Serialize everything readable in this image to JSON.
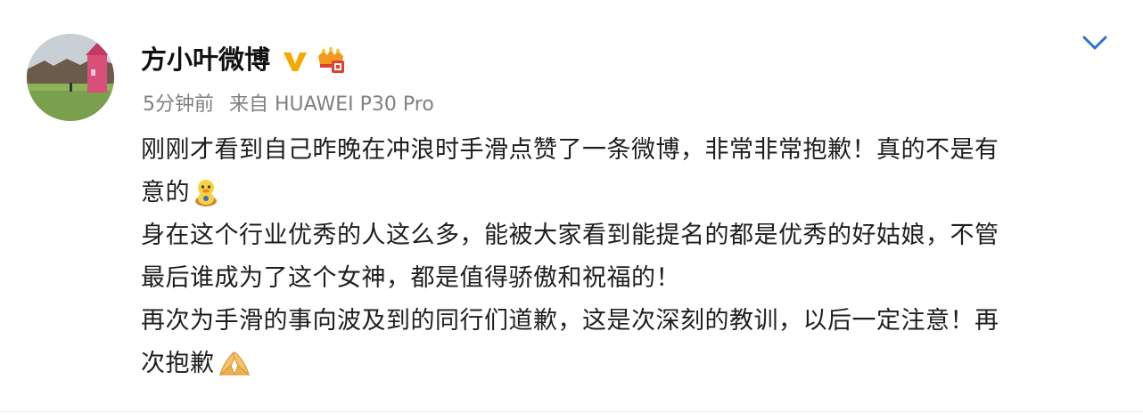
{
  "post": {
    "username": "方小叶微博",
    "time": "5分钟前",
    "source": "来自 HUAWEI P30 Pro",
    "lines": [
      "刚刚才看到自己昨晚在冲浪时手滑点赞了一条微博，非常非常抱歉！真的不是有",
      "意的",
      "身在这个行业优秀的人这么多，能被大家看到能提名的都是优秀的好姑娘，不管",
      "最后谁成为了这个女神，都是值得骄傲和祝福的！",
      "再次为手滑的事向波及到的同行们道歉，这是次深刻的教训，以后一定注意！再",
      "次抱歉"
    ],
    "badges": [
      "verified-v-icon",
      "vip-crown-icon"
    ],
    "emojis": [
      "duck-emoji-icon",
      "pray-hands-emoji-icon"
    ]
  },
  "colors": {
    "verified": "#f6a800",
    "text": "#1e1e1e",
    "meta": "#808080",
    "chevron": "#2a72c8"
  }
}
